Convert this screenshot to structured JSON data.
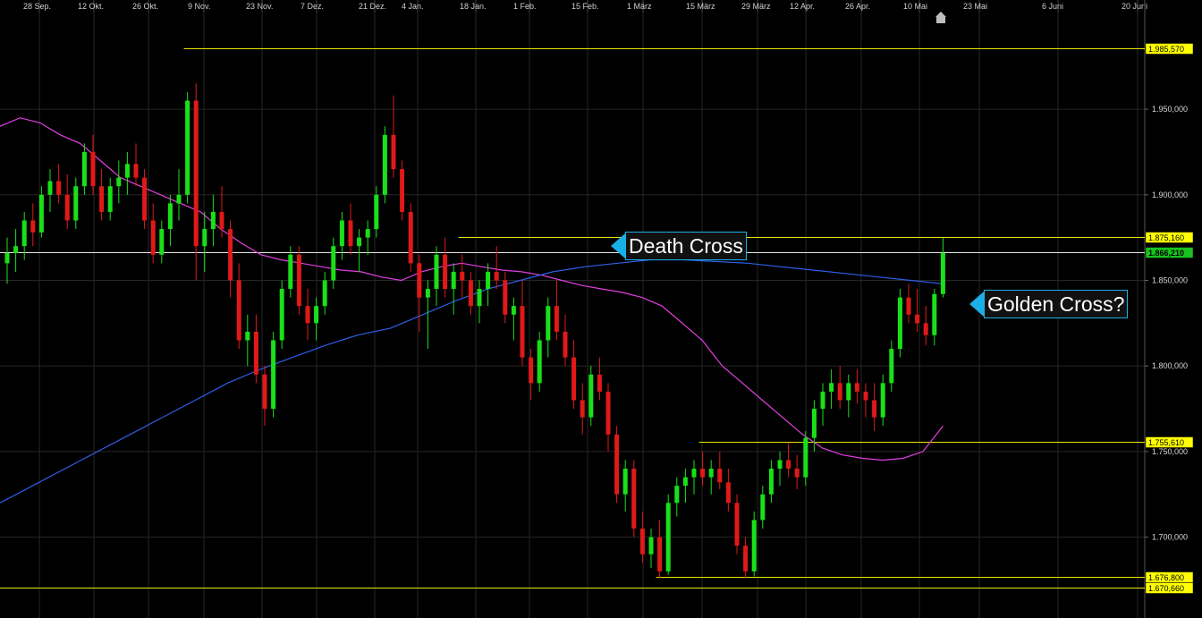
{
  "chart_data": {
    "type": "candlestick",
    "x_tick_labels": [
      "28 Sep.",
      "12 Okt.",
      "26 Okt.",
      "9 Nov.",
      "23 Nov.",
      "7 Dez.",
      "21 Dez.",
      "4 Jan.",
      "18 Jan.",
      "1 Feb.",
      "15 Feb.",
      "1 März",
      "15 März",
      "29 März",
      "12 Apr.",
      "26 Apr.",
      "10 Mai",
      "23 Mai",
      "6 Juni",
      "20 Juni"
    ],
    "y_tick_labels": [
      "1.950,000",
      "1.900,000",
      "1.850,000",
      "1.800,000",
      "1.750,000",
      "1.700,000"
    ],
    "y_ticks": [
      1950,
      1900,
      1850,
      1800,
      1750,
      1700
    ],
    "ylim": [
      1663,
      1990
    ],
    "candles": [
      [
        1860,
        1875,
        1848,
        1866
      ],
      [
        1866,
        1880,
        1855,
        1870
      ],
      [
        1870,
        1890,
        1862,
        1885
      ],
      [
        1885,
        1895,
        1870,
        1878
      ],
      [
        1878,
        1905,
        1875,
        1900
      ],
      [
        1900,
        1915,
        1890,
        1908
      ],
      [
        1908,
        1918,
        1895,
        1900
      ],
      [
        1900,
        1912,
        1880,
        1885
      ],
      [
        1885,
        1910,
        1880,
        1905
      ],
      [
        1905,
        1930,
        1900,
        1925
      ],
      [
        1925,
        1935,
        1900,
        1905
      ],
      [
        1905,
        1915,
        1885,
        1890
      ],
      [
        1890,
        1910,
        1885,
        1905
      ],
      [
        1905,
        1920,
        1895,
        1910
      ],
      [
        1910,
        1925,
        1900,
        1918
      ],
      [
        1918,
        1930,
        1905,
        1910
      ],
      [
        1910,
        1915,
        1880,
        1885
      ],
      [
        1885,
        1895,
        1860,
        1865
      ],
      [
        1865,
        1885,
        1860,
        1880
      ],
      [
        1880,
        1900,
        1870,
        1895
      ],
      [
        1895,
        1915,
        1885,
        1900
      ],
      [
        1900,
        1960,
        1895,
        1955
      ],
      [
        1955,
        1965,
        1850,
        1870
      ],
      [
        1870,
        1890,
        1855,
        1880
      ],
      [
        1880,
        1900,
        1870,
        1890
      ],
      [
        1890,
        1905,
        1875,
        1880
      ],
      [
        1880,
        1885,
        1840,
        1850
      ],
      [
        1850,
        1860,
        1810,
        1815
      ],
      [
        1815,
        1830,
        1800,
        1820
      ],
      [
        1820,
        1830,
        1790,
        1795
      ],
      [
        1795,
        1800,
        1765,
        1775
      ],
      [
        1775,
        1820,
        1770,
        1815
      ],
      [
        1815,
        1850,
        1810,
        1845
      ],
      [
        1845,
        1870,
        1840,
        1865
      ],
      [
        1865,
        1870,
        1830,
        1835
      ],
      [
        1835,
        1845,
        1815,
        1825
      ],
      [
        1825,
        1840,
        1815,
        1835
      ],
      [
        1835,
        1855,
        1830,
        1850
      ],
      [
        1850,
        1875,
        1845,
        1870
      ],
      [
        1870,
        1890,
        1862,
        1885
      ],
      [
        1885,
        1895,
        1865,
        1870
      ],
      [
        1870,
        1880,
        1855,
        1875
      ],
      [
        1875,
        1885,
        1865,
        1880
      ],
      [
        1880,
        1905,
        1875,
        1900
      ],
      [
        1900,
        1940,
        1895,
        1935
      ],
      [
        1935,
        1958,
        1910,
        1915
      ],
      [
        1915,
        1920,
        1885,
        1890
      ],
      [
        1890,
        1895,
        1855,
        1860
      ],
      [
        1860,
        1865,
        1820,
        1840
      ],
      [
        1840,
        1850,
        1810,
        1845
      ],
      [
        1845,
        1870,
        1835,
        1865
      ],
      [
        1865,
        1875,
        1840,
        1845
      ],
      [
        1845,
        1860,
        1830,
        1855
      ],
      [
        1855,
        1865,
        1840,
        1850
      ],
      [
        1850,
        1855,
        1830,
        1835
      ],
      [
        1835,
        1850,
        1825,
        1845
      ],
      [
        1845,
        1860,
        1835,
        1855
      ],
      [
        1855,
        1870,
        1845,
        1850
      ],
      [
        1850,
        1855,
        1825,
        1830
      ],
      [
        1830,
        1840,
        1815,
        1835
      ],
      [
        1835,
        1850,
        1800,
        1805
      ],
      [
        1805,
        1810,
        1780,
        1790
      ],
      [
        1790,
        1820,
        1785,
        1815
      ],
      [
        1815,
        1840,
        1805,
        1835
      ],
      [
        1835,
        1850,
        1815,
        1820
      ],
      [
        1820,
        1830,
        1800,
        1805
      ],
      [
        1805,
        1815,
        1775,
        1780
      ],
      [
        1780,
        1790,
        1760,
        1770
      ],
      [
        1770,
        1800,
        1765,
        1795
      ],
      [
        1795,
        1805,
        1780,
        1785
      ],
      [
        1785,
        1790,
        1750,
        1760
      ],
      [
        1760,
        1765,
        1720,
        1725
      ],
      [
        1725,
        1745,
        1715,
        1740
      ],
      [
        1740,
        1745,
        1700,
        1705
      ],
      [
        1705,
        1715,
        1685,
        1690
      ],
      [
        1690,
        1705,
        1682,
        1700
      ],
      [
        1700,
        1710,
        1676,
        1680
      ],
      [
        1680,
        1725,
        1678,
        1720
      ],
      [
        1720,
        1735,
        1712,
        1730
      ],
      [
        1730,
        1740,
        1720,
        1735
      ],
      [
        1735,
        1745,
        1725,
        1740
      ],
      [
        1740,
        1750,
        1730,
        1735
      ],
      [
        1735,
        1745,
        1725,
        1740
      ],
      [
        1740,
        1750,
        1728,
        1732
      ],
      [
        1732,
        1740,
        1715,
        1720
      ],
      [
        1720,
        1725,
        1690,
        1695
      ],
      [
        1695,
        1700,
        1676,
        1680
      ],
      [
        1680,
        1715,
        1677,
        1710
      ],
      [
        1710,
        1730,
        1705,
        1725
      ],
      [
        1725,
        1745,
        1720,
        1740
      ],
      [
        1740,
        1750,
        1730,
        1745
      ],
      [
        1745,
        1755,
        1735,
        1740
      ],
      [
        1740,
        1748,
        1728,
        1735
      ],
      [
        1735,
        1762,
        1730,
        1758
      ],
      [
        1758,
        1780,
        1750,
        1775
      ],
      [
        1775,
        1790,
        1765,
        1785
      ],
      [
        1785,
        1798,
        1775,
        1790
      ],
      [
        1790,
        1800,
        1775,
        1780
      ],
      [
        1780,
        1795,
        1770,
        1790
      ],
      [
        1790,
        1798,
        1778,
        1785
      ],
      [
        1785,
        1790,
        1770,
        1780
      ],
      [
        1780,
        1790,
        1762,
        1770
      ],
      [
        1770,
        1795,
        1765,
        1790
      ],
      [
        1790,
        1815,
        1785,
        1810
      ],
      [
        1810,
        1845,
        1805,
        1840
      ],
      [
        1840,
        1848,
        1825,
        1830
      ],
      [
        1830,
        1845,
        1820,
        1825
      ],
      [
        1825,
        1835,
        1812,
        1818
      ],
      [
        1818,
        1845,
        1812,
        1842
      ],
      [
        1842,
        1875,
        1840,
        1866
      ]
    ],
    "series": [
      {
        "name": "",
        "color": "#e040e0",
        "values": [
          1940,
          1945,
          1942,
          1935,
          1930,
          1920,
          1910,
          1905,
          1900,
          1895,
          1890,
          1880,
          1872,
          1865,
          1862,
          1860,
          1858,
          1856,
          1855,
          1852,
          1850,
          1855,
          1858,
          1860,
          1858,
          1856,
          1855,
          1853,
          1850,
          1847,
          1845,
          1843,
          1840,
          1835,
          1825,
          1815,
          1800,
          1790,
          1780,
          1770,
          1760,
          1752,
          1748,
          1746,
          1745,
          1746,
          1750,
          1765
        ],
        "x_end_index": 109
      },
      {
        "name": "",
        "color": "#2f5fe8",
        "values": [
          1720,
          1730,
          1740,
          1750,
          1760,
          1770,
          1780,
          1790,
          1798,
          1805,
          1812,
          1818,
          1822,
          1830,
          1838,
          1845,
          1850,
          1855,
          1858,
          1860,
          1862,
          1862,
          1861,
          1860,
          1858,
          1856,
          1854,
          1852,
          1850,
          1848
        ],
        "x_end_index": 109
      }
    ],
    "horizontal_levels": [
      {
        "value": 1985.57,
        "label": "1.985,570",
        "from_index": 21,
        "color": "#ffff00"
      },
      {
        "value": 1875.16,
        "label": "1.875,160",
        "from_index": 53,
        "color": "#ffff00"
      },
      {
        "value": 1866.21,
        "label": "1.866,210",
        "from_index": 0,
        "color": "#ffffff",
        "badge": "#19c21f"
      },
      {
        "value": 1755.61,
        "label": "1.755,610",
        "from_index": 81,
        "color": "#ffff00"
      },
      {
        "value": 1676.8,
        "label": "1.676,800",
        "from_index": 76,
        "color": "#ffff00"
      },
      {
        "value": 1670.66,
        "label": "1.670,660",
        "from_index": 0,
        "color": "#ffff00"
      }
    ],
    "annotations": [
      "Death Cross",
      "Golden Cross?"
    ],
    "grid": true,
    "up_color": "#19e019",
    "down_color": "#e01919"
  }
}
